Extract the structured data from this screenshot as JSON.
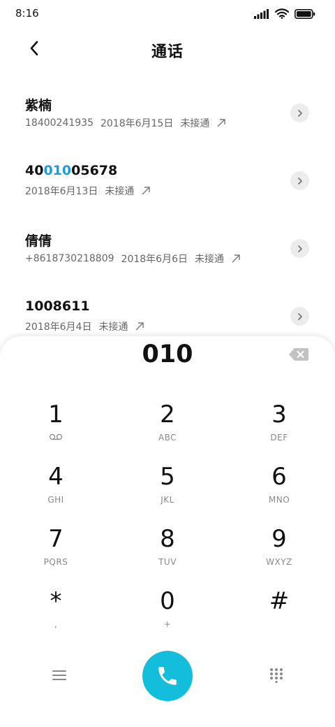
{
  "status_bar": {
    "time": "8:16",
    "icons": [
      "signal-icon",
      "wifi-icon",
      "battery-icon"
    ]
  },
  "header": {
    "title": "通话",
    "back_icon": "chevron-left-icon"
  },
  "calls": [
    {
      "name_parts": [
        {
          "text": "紫楠",
          "highlight": false
        }
      ],
      "number": "18400241935",
      "date": "2018年6月15日",
      "status": "未接通",
      "direction_icon": "outgoing-arrow-icon"
    },
    {
      "name_parts": [
        {
          "text": "40",
          "highlight": false
        },
        {
          "text": "010",
          "highlight": true
        },
        {
          "text": "05678",
          "highlight": false
        }
      ],
      "number": "",
      "date": "2018年6月13日",
      "status": "未接通",
      "direction_icon": "outgoing-arrow-icon"
    },
    {
      "name_parts": [
        {
          "text": "倩倩",
          "highlight": false
        }
      ],
      "number": "+8618730218809",
      "date": "2018年6月6日",
      "status": "未接通",
      "direction_icon": "outgoing-arrow-icon"
    },
    {
      "name_parts": [
        {
          "text": "1008611",
          "highlight": false
        }
      ],
      "number": "",
      "date": "2018年6月4日",
      "status": "未接通",
      "direction_icon": "outgoing-arrow-icon"
    }
  ],
  "dialer": {
    "entered_number": "010",
    "keys": [
      {
        "digit": "1",
        "letters": "",
        "icon": "voicemail-icon"
      },
      {
        "digit": "2",
        "letters": "ABC"
      },
      {
        "digit": "3",
        "letters": "DEF"
      },
      {
        "digit": "4",
        "letters": "GHI"
      },
      {
        "digit": "5",
        "letters": "JKL"
      },
      {
        "digit": "6",
        "letters": "MNO"
      },
      {
        "digit": "7",
        "letters": "PQRS"
      },
      {
        "digit": "8",
        "letters": "TUV"
      },
      {
        "digit": "9",
        "letters": "WXYZ"
      },
      {
        "digit": "*",
        "letters": ","
      },
      {
        "digit": "0",
        "letters": "+"
      },
      {
        "digit": "#",
        "letters": ""
      }
    ],
    "accent_color": "#12bedc",
    "highlight_color": "#1a9de0"
  }
}
